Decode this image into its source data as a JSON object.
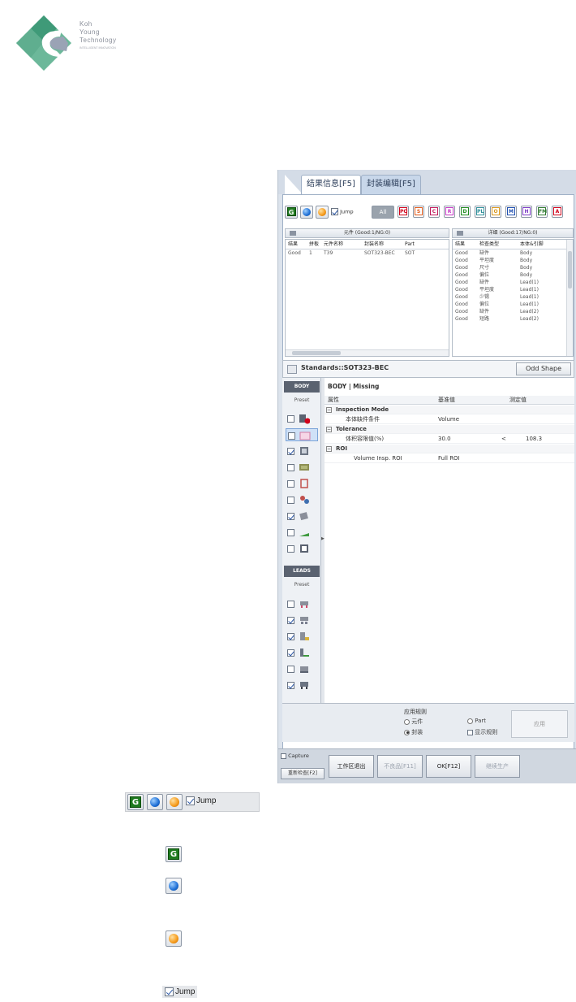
{
  "logo": {
    "line1": "Koh",
    "line2": "Young",
    "line3": "Technology",
    "tagline": "INTELLIGENT INNOVATION"
  },
  "tabs": {
    "active": "结果信息[F5]",
    "inactive": "封装编辑[F5]"
  },
  "toolbar": {
    "green_label": "G",
    "jump_label": "Jump",
    "all_label": "All",
    "filters": [
      {
        "label": "PO",
        "color": "#d0021b"
      },
      {
        "label": "S",
        "color": "#e05a1b"
      },
      {
        "label": "C",
        "color": "#c0185a"
      },
      {
        "label": "R",
        "color": "#c43ac4"
      },
      {
        "label": "D",
        "color": "#1f8a1f"
      },
      {
        "label": "PL",
        "color": "#2f8f9a"
      },
      {
        "label": "O",
        "color": "#d8961a"
      },
      {
        "label": "M",
        "color": "#1f4fb0"
      },
      {
        "label": "H",
        "color": "#7a3ac4"
      },
      {
        "label": "FM",
        "color": "#2f7a2f"
      },
      {
        "label": "A",
        "color": "#d0021b"
      }
    ]
  },
  "component_pane": {
    "title": "元件 (Good:1/NG:0)",
    "columns": [
      "结果",
      "拼板",
      "元件名称",
      "封装名称",
      "Part"
    ],
    "rows": [
      [
        "Good",
        "1",
        "T39",
        "SOT323-BEC",
        "SOT"
      ]
    ]
  },
  "detail_pane": {
    "title": "详细 (Good:17/NG:0)",
    "columns": [
      "结果",
      "检查类型",
      "本体&引脚"
    ],
    "rows": [
      [
        "Good",
        "缺件",
        "Body"
      ],
      [
        "Good",
        "平坦度",
        "Body"
      ],
      [
        "Good",
        "尺寸",
        "Body"
      ],
      [
        "Good",
        "偏位",
        "Body"
      ],
      [
        "Good",
        "缺件",
        "Lead(1)"
      ],
      [
        "Good",
        "平坦度",
        "Lead(1)"
      ],
      [
        "Good",
        "少锡",
        "Lead(1)"
      ],
      [
        "Good",
        "偏位",
        "Lead(1)"
      ],
      [
        "Good",
        "缺件",
        "Lead(2)"
      ],
      [
        "Good",
        "短路",
        "Lead(2)"
      ]
    ]
  },
  "standards": {
    "title": "Standards::SOT323-BEC",
    "odd_shape": "Odd Shape"
  },
  "left_column": {
    "body_header": "BODY",
    "body_preset": "Preset",
    "leads_header": "LEADS",
    "leads_preset": "Preset",
    "body_items": [
      {
        "checked": false,
        "icon": "missing-icon"
      },
      {
        "checked": false,
        "icon": "body-outline-icon"
      },
      {
        "checked": true,
        "icon": "dimension-icon"
      },
      {
        "checked": false,
        "icon": "polarity-icon"
      },
      {
        "checked": false,
        "icon": "rotation-icon"
      },
      {
        "checked": false,
        "icon": "flipped-icon"
      },
      {
        "checked": true,
        "icon": "offset-icon"
      },
      {
        "checked": false,
        "icon": "height-icon"
      },
      {
        "checked": false,
        "icon": "ocr-icon"
      }
    ],
    "lead_items": [
      {
        "checked": false,
        "icon": "lead-missing-icon"
      },
      {
        "checked": true,
        "icon": "lead-lift-icon"
      },
      {
        "checked": true,
        "icon": "lead-solder-icon"
      },
      {
        "checked": true,
        "icon": "lead-fillet-icon"
      },
      {
        "checked": false,
        "icon": "lead-bridge-icon"
      },
      {
        "checked": true,
        "icon": "lead-offset-icon"
      }
    ]
  },
  "property_grid": {
    "title": "BODY | Missing",
    "headers": {
      "property": "属性",
      "standard": "基准值",
      "measured": "测定值"
    },
    "cat1": "Inspection Mode",
    "row1": {
      "name": "本体缺件条件",
      "value": "Volume"
    },
    "cat2": "Tolerance",
    "row2": {
      "name": "体积容限值(%)",
      "value": "30.0",
      "cmp": "<",
      "measured": "108.3"
    },
    "cat3": "ROI",
    "row3": {
      "name": "Volume Insp. ROI",
      "value": "Full ROI"
    }
  },
  "apply_rules": {
    "label": "应用规则",
    "opt_component": "元件",
    "opt_part": "Part",
    "opt_package": "封装",
    "opt_show": "显示规则",
    "apply_button": "应用"
  },
  "bottom": {
    "capture": "Capture",
    "recheck": "重新检查[F2]",
    "work_exit": "工作区退出",
    "ng_button": "不良品[F11]",
    "ok_button": "OK[F12]",
    "continue": "继续生产"
  },
  "legend": {
    "green": "G",
    "jump": "Jump"
  }
}
